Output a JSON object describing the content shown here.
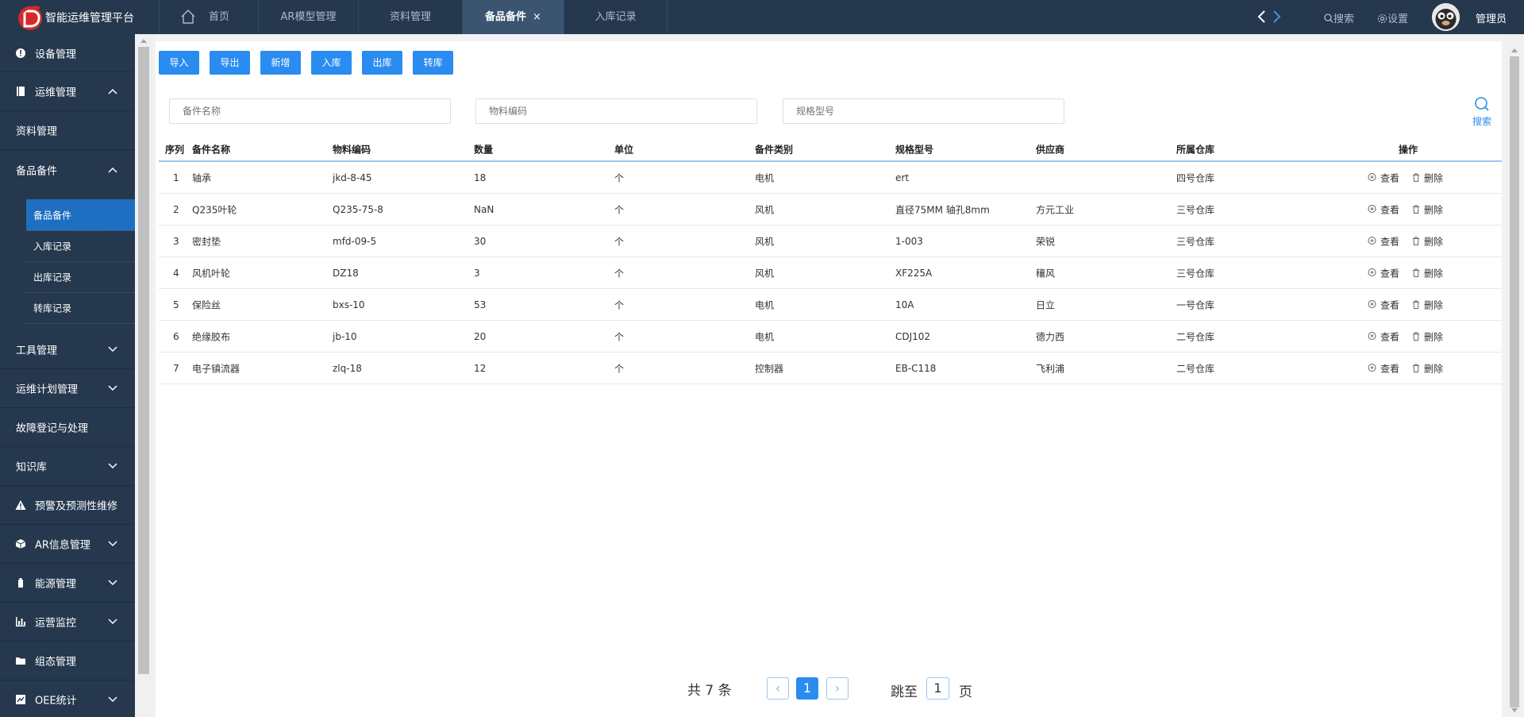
{
  "app": {
    "title": "智能运维管理平台",
    "brand_color": "#25384e",
    "accent": "#2a8cf0"
  },
  "tabs": [
    {
      "label": "首页"
    },
    {
      "label": "AR模型管理"
    },
    {
      "label": "资料管理"
    },
    {
      "label": "备品备件",
      "close": "×"
    },
    {
      "label": "入库记录"
    }
  ],
  "header": {
    "search_label": "搜索",
    "settings_label": "设置",
    "user_name": "管理员"
  },
  "sidebar": {
    "items": [
      {
        "label": "设备管理",
        "icon": "info-circle-icon"
      },
      {
        "label": "运维管理",
        "icon": "book-icon"
      },
      {
        "label": "资料管理"
      },
      {
        "label": "备品备件"
      },
      {
        "label": "工具管理"
      },
      {
        "label": "运维计划管理"
      },
      {
        "label": "故障登记与处理"
      },
      {
        "label": "知识库"
      },
      {
        "label": "预警及预测性维修",
        "icon": "warning-icon"
      },
      {
        "label": "AR信息管理",
        "icon": "cube-icon"
      },
      {
        "label": "能源管理",
        "icon": "battery-icon"
      },
      {
        "label": "运营监控",
        "icon": "bar-chart-icon"
      },
      {
        "label": "组态管理",
        "icon": "folder-icon"
      },
      {
        "label": "OEE统计",
        "icon": "line-chart-icon"
      }
    ],
    "sub_items": [
      {
        "label": "备品备件"
      },
      {
        "label": "入库记录"
      },
      {
        "label": "出库记录"
      },
      {
        "label": "转库记录"
      }
    ]
  },
  "toolbar": {
    "import": "导入",
    "export": "导出",
    "add": "新增",
    "stock_in": "入库",
    "stock_out": "出库",
    "transfer": "转库"
  },
  "filters": {
    "name_placeholder": "备件名称",
    "code_placeholder": "物料编码",
    "spec_placeholder": "规格型号",
    "search_label": "搜索"
  },
  "table": {
    "headers": [
      "序列",
      "备件名称",
      "物料编码",
      "数量",
      "单位",
      "备件类别",
      "规格型号",
      "供应商",
      "所属仓库",
      "操作"
    ],
    "rows": [
      [
        "1",
        "轴承",
        "jkd-8-45",
        "18",
        "个",
        "电机",
        "ert",
        "",
        "四号仓库"
      ],
      [
        "2",
        "Q235叶轮",
        "Q235-75-8",
        "NaN",
        "个",
        "风机",
        "直径75MM 轴孔8mm",
        "方元工业",
        "三号仓库"
      ],
      [
        "3",
        "密封垫",
        "mfd-09-5",
        "30",
        "个",
        "风机",
        "1-003",
        "荣锐",
        "三号仓库"
      ],
      [
        "4",
        "风机叶轮",
        "DZ18",
        "3",
        "个",
        "风机",
        "XF225A",
        "穰风",
        "三号仓库"
      ],
      [
        "5",
        "保险丝",
        "bxs-10",
        "53",
        "个",
        "电机",
        "10A",
        "日立",
        "一号仓库"
      ],
      [
        "6",
        "绝缘胶布",
        "jb-10",
        "20",
        "个",
        "电机",
        "CDJ102",
        "德力西",
        "二号仓库"
      ],
      [
        "7",
        "电子镇流器",
        "zlq-18",
        "12",
        "个",
        "控制器",
        "EB-C118",
        "飞利浦",
        "二号仓库"
      ]
    ],
    "view_label": "查看",
    "delete_label": "删除"
  },
  "pagination": {
    "total_text": "共 7 条",
    "prev": "‹",
    "next": "›",
    "current_page": "1",
    "jump_label": "跳至",
    "jump_value": "1",
    "page_unit": "页"
  }
}
